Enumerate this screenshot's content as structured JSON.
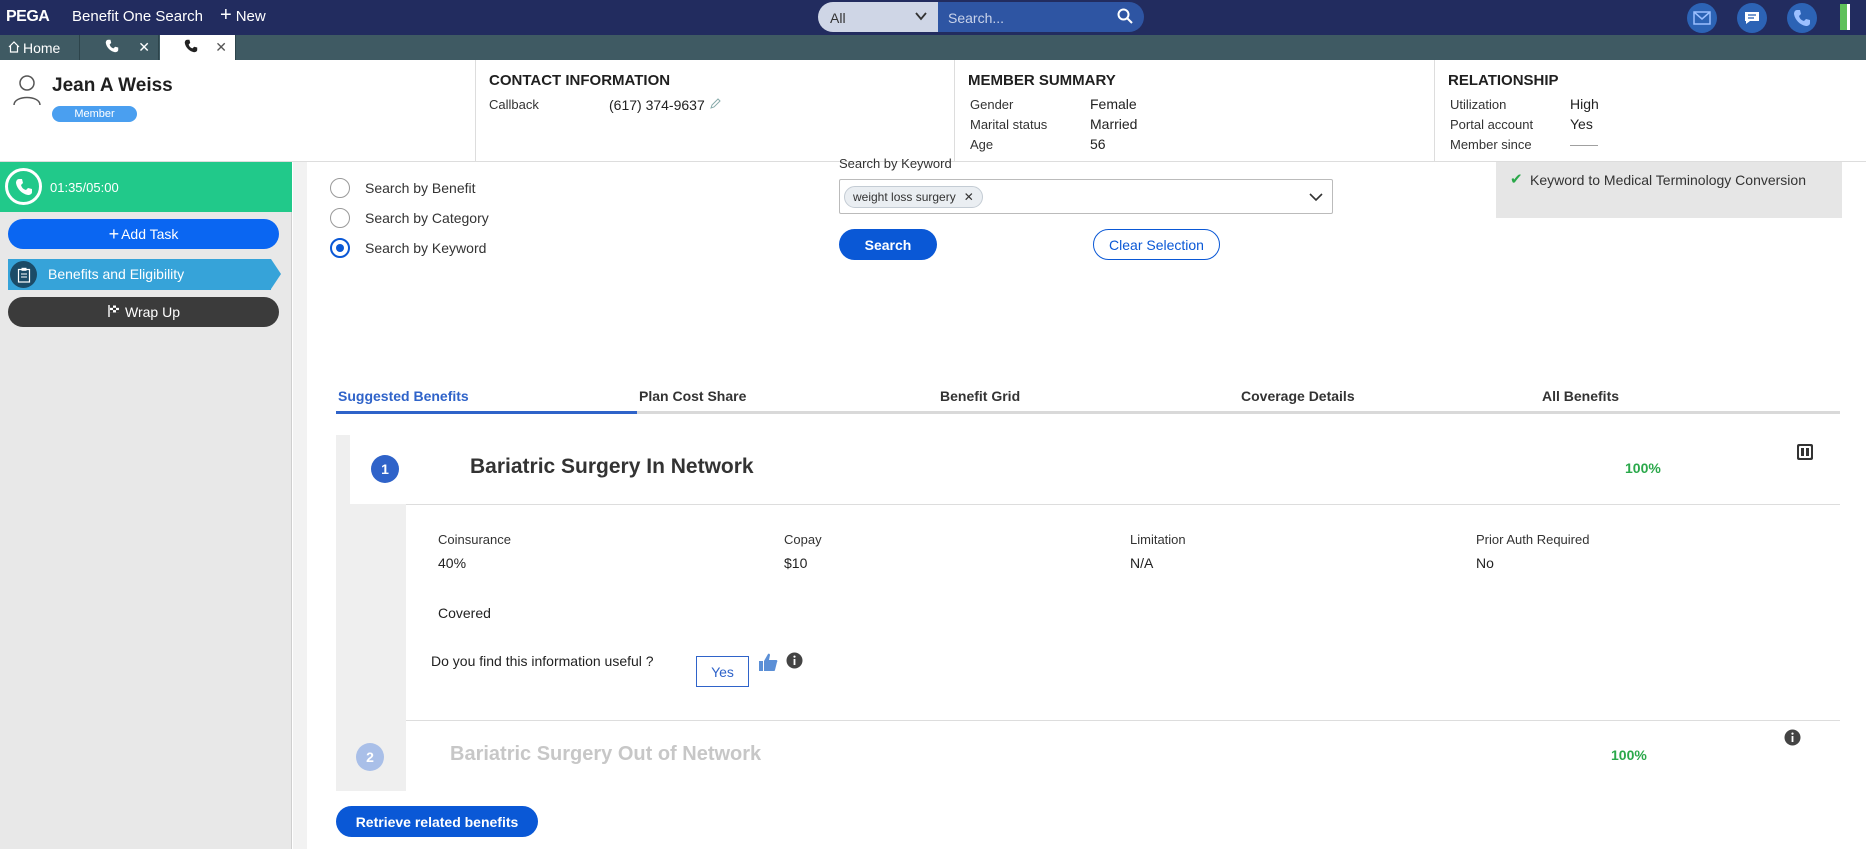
{
  "topbar": {
    "logo": "PEGA",
    "app_title": "Benefit One Search",
    "new_label": "New",
    "search_scope": "All",
    "search_placeholder": "Search..."
  },
  "tabs": {
    "home_label": "Home"
  },
  "member": {
    "name": "Jean A Weiss",
    "badge": "Member"
  },
  "contact": {
    "title": "CONTACT INFORMATION",
    "callback_label": "Callback",
    "callback_value": "(617) 374-9637"
  },
  "summary": {
    "title": "MEMBER SUMMARY",
    "gender_label": "Gender",
    "gender_value": "Female",
    "marital_label": "Marital status",
    "marital_value": "Married",
    "age_label": "Age",
    "age_value": "56"
  },
  "relationship": {
    "title": "RELATIONSHIP",
    "utilization_label": "Utilization",
    "utilization_value": "High",
    "portal_label": "Portal account",
    "portal_value": "Yes",
    "since_label": "Member since",
    "since_value": "——"
  },
  "sidebar": {
    "timer": "01:35/05:00",
    "add_task": "Add Task",
    "benefits": "Benefits and Eligibility",
    "wrap_up": "Wrap Up"
  },
  "search": {
    "options": [
      "Search by Benefit",
      "Search by Category",
      "Search by Keyword"
    ],
    "keyword_label": "Search by Keyword",
    "chip": "weight loss surgery",
    "search_btn": "Search",
    "clear_btn": "Clear Selection",
    "conversion": "Keyword to Medical Terminology Conversion"
  },
  "results_tabs": [
    "Suggested Benefits",
    "Plan Cost Share",
    "Benefit Grid",
    "Coverage Details",
    "All Benefits"
  ],
  "benefit1": {
    "num": "1",
    "title": "Bariatric Surgery In Network",
    "pct": "100%",
    "fields": [
      {
        "label": "Coinsurance",
        "value": "40%"
      },
      {
        "label": "Copay",
        "value": "$10"
      },
      {
        "label": "Limitation",
        "value": "N/A"
      },
      {
        "label": "Prior Auth Required",
        "value": "No"
      }
    ],
    "status": "Covered",
    "useful_q": "Do you find this information useful ?",
    "yes": "Yes"
  },
  "benefit2": {
    "num": "2",
    "title": "Bariatric Surgery Out of Network",
    "pct": "100%"
  },
  "retrieve_btn": "Retrieve related benefits",
  "colors": {
    "topbar": "#222c5f",
    "primary": "#0a58d6",
    "timer": "#21c98a",
    "nav": "#36a3d9",
    "success": "#2aa84a"
  }
}
